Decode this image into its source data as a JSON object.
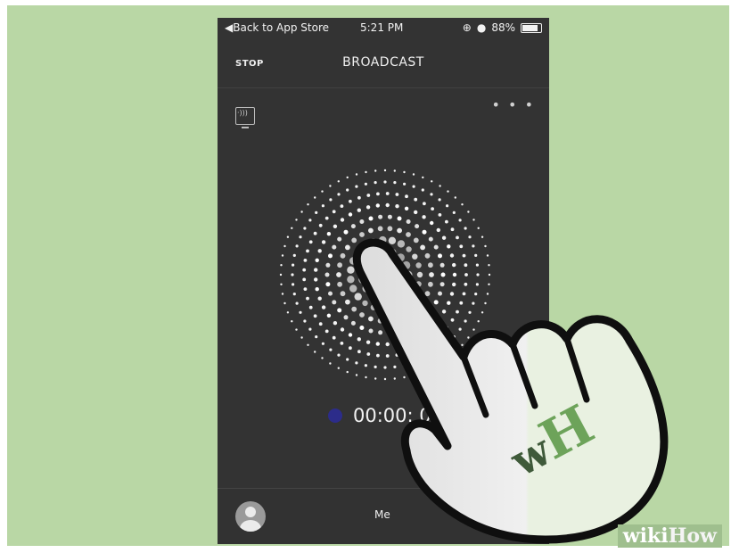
{
  "status_bar": {
    "back": "Back to App Store",
    "time": "5:21 PM",
    "battery": "88%"
  },
  "nav": {
    "stop": "STOP",
    "title": "BROADCAST"
  },
  "more_menu": "• • •",
  "timer": {
    "text": "00:00: 0"
  },
  "tab_bar": {
    "me": "Me"
  },
  "logo": {
    "text": "wH",
    "watermark_a": "wiki",
    "watermark_b": "How"
  },
  "colors": {
    "background": "#b9d7a5",
    "phone": "#333333",
    "record_dot": "#2c2c8a",
    "logo_green": "#6da35a",
    "logo_dark": "#3f5a3a"
  }
}
